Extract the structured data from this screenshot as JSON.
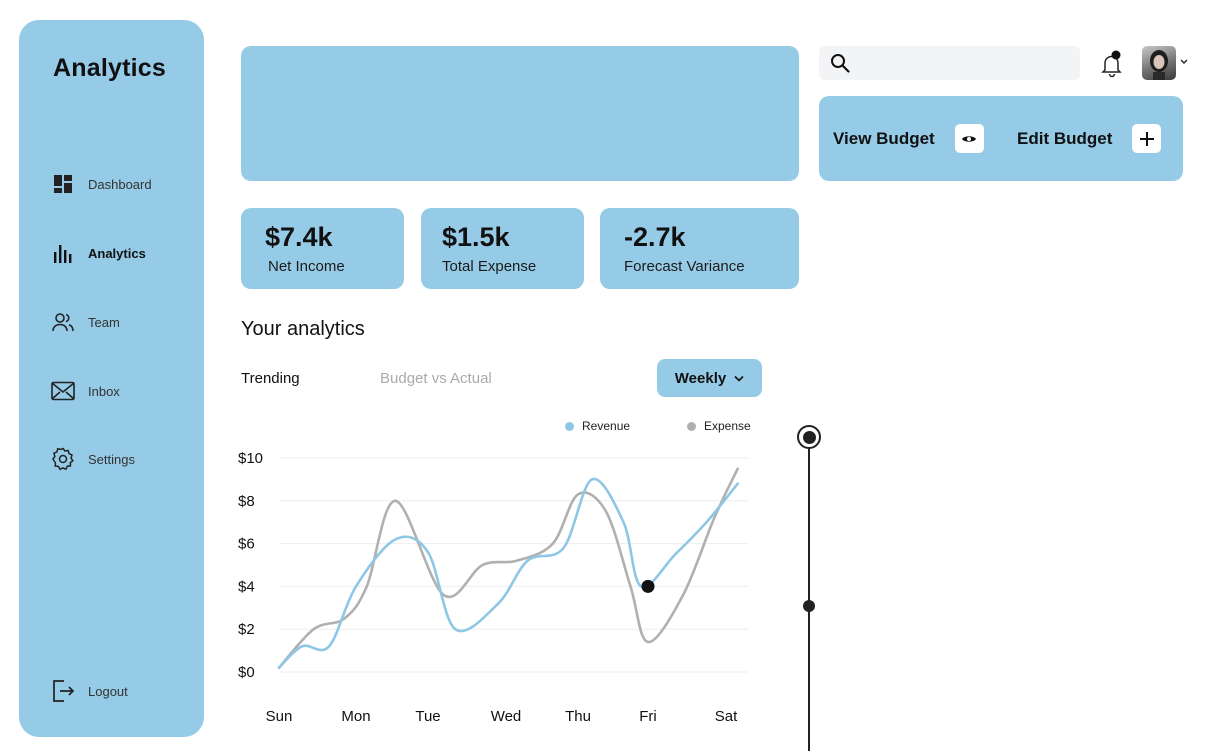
{
  "sidebar": {
    "title": "Analytics",
    "items": [
      {
        "label": "Dashboard",
        "icon": "dashboard-icon"
      },
      {
        "label": "Analytics",
        "icon": "bar-chart-icon"
      },
      {
        "label": "Team",
        "icon": "team-icon"
      },
      {
        "label": "Inbox",
        "icon": "mail-icon"
      },
      {
        "label": "Settings",
        "icon": "gear-icon"
      }
    ],
    "logout_label": "Logout"
  },
  "stats": [
    {
      "value": "$7.4k",
      "label": "Net Income"
    },
    {
      "value": "$1.5k",
      "label": "Total Expense"
    },
    {
      "value": "-2.7k",
      "label": "Forecast Variance"
    }
  ],
  "analytics": {
    "title": "Your analytics",
    "tabs": [
      "Trending",
      "Budget vs Actual"
    ],
    "period": "Weekly"
  },
  "header": {
    "search_placeholder": "",
    "notification_dot": true
  },
  "budget": {
    "view_label": "View Budget",
    "edit_label": "Edit Budget"
  },
  "colors": {
    "accent": "#96cbe7",
    "revenue": "#8ec7e6",
    "expense": "#b0b0b0",
    "text": "#111111"
  },
  "chart_data": {
    "type": "line",
    "categories": [
      "Sun",
      "Mon",
      "Tue",
      "Wed",
      "Thu",
      "Fri",
      "Sat"
    ],
    "y_ticks": [
      "$0",
      "$2",
      "$4",
      "$6",
      "$8",
      "$10"
    ],
    "ylim": [
      0,
      10
    ],
    "grid": true,
    "legend": "top-right",
    "series": [
      {
        "name": "Revenue",
        "color": "#8ec7e6",
        "x": [
          0,
          0.3,
          0.65,
          1.0,
          1.55,
          2.0,
          2.35,
          2.9,
          3.3,
          3.8,
          4.2,
          4.65,
          4.9,
          5.35,
          5.75,
          6.15
        ],
        "y": [
          0.2,
          1.2,
          1.2,
          4.0,
          6.2,
          5.6,
          2.0,
          3.2,
          5.2,
          5.8,
          9.0,
          7.0,
          4.0,
          5.5,
          7.0,
          8.8
        ]
      },
      {
        "name": "Expense",
        "color": "#b0b0b0",
        "x": [
          0,
          0.45,
          0.85,
          1.15,
          1.55,
          2.2,
          2.7,
          3.15,
          3.65,
          4.0,
          4.4,
          4.75,
          5.0,
          5.45,
          5.85,
          6.15
        ],
        "y": [
          0.2,
          2.0,
          2.5,
          4.0,
          8.0,
          3.6,
          5.0,
          5.2,
          6.0,
          8.3,
          7.5,
          4.0,
          1.4,
          3.6,
          7.2,
          9.5
        ]
      }
    ],
    "highlight": {
      "x": 5,
      "y": 4.0
    }
  }
}
